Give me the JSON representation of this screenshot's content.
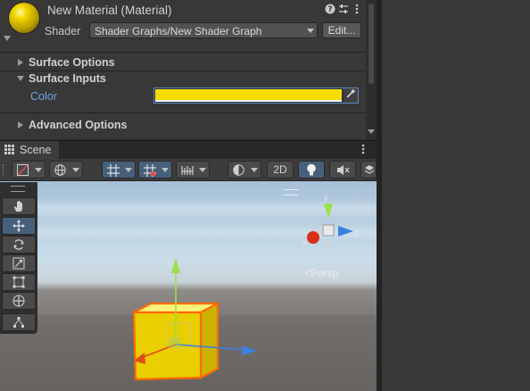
{
  "material": {
    "title": "New Material (Material)",
    "icons": {
      "help": "help-icon",
      "presets": "presets-sliders-icon",
      "menu": "kebab-menu-icon"
    },
    "shader_label": "Shader",
    "shader_value": "Shader Graphs/New Shader Graph",
    "edit_label": "Edit...",
    "sections": {
      "surface_options": "Surface Options",
      "surface_inputs": "Surface Inputs",
      "advanced_options": "Advanced Options"
    },
    "color_label": "Color",
    "color_value": "#f8dc00"
  },
  "scene": {
    "tab_label": "Scene",
    "toolbar": {
      "mode_2d": "2D"
    },
    "view_label": "Persp"
  },
  "tools": [
    "hand-tool",
    "move-tool",
    "rotate-tool",
    "scale-tool",
    "rect-tool",
    "transform-tool",
    "custom-tool"
  ],
  "colors": {
    "accent": "#46607c",
    "selection_outline": "#ff6a00",
    "cube": "#f2d400"
  }
}
